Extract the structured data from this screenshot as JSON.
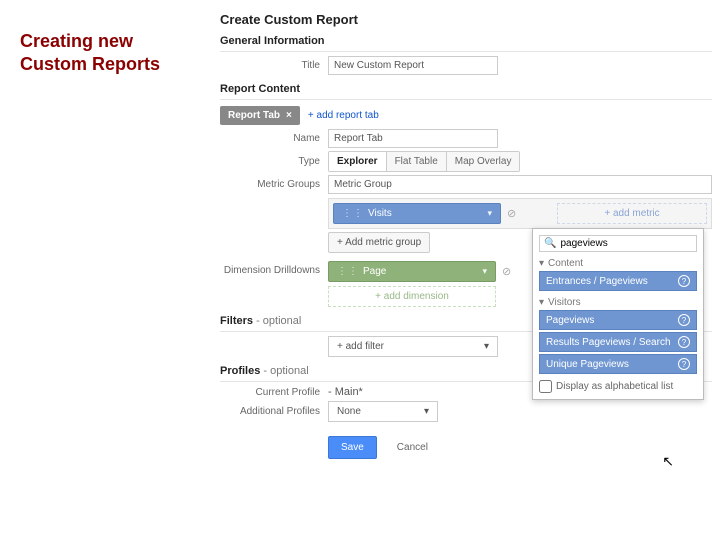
{
  "slide_title": "Creating new Custom Reports",
  "header": {
    "title": "Create Custom Report"
  },
  "general": {
    "heading": "General Information",
    "title_label": "Title",
    "title_value": "New Custom Report"
  },
  "content": {
    "heading": "Report Content",
    "active_tab": "Report Tab",
    "add_tab": "+ add report tab",
    "name_label": "Name",
    "name_value": "Report Tab",
    "type_label": "Type",
    "type_options": [
      "Explorer",
      "Flat Table",
      "Map Overlay"
    ],
    "type_selected": "Explorer",
    "metric_groups_label": "Metric Groups",
    "metric_group_name": "Metric Group",
    "metric_pill": "Visits",
    "add_metric": "+ add metric",
    "add_metric_group": "+ Add metric group",
    "dim_label": "Dimension Drilldowns",
    "dim_pill": "Page",
    "add_dimension": "+ add dimension"
  },
  "filters": {
    "heading": "Filters",
    "optional": " - optional",
    "add_filter": "+ add filter"
  },
  "profiles": {
    "heading": "Profiles",
    "optional": " - optional",
    "current_label": "Current Profile",
    "current_value": "- Main*",
    "additional_label": "Additional Profiles",
    "additional_value": "None"
  },
  "actions": {
    "save": "Save",
    "cancel": "Cancel"
  },
  "picker": {
    "search_value": "pageviews",
    "groups": [
      {
        "name": "Content",
        "items": [
          "Entrances / Pageviews"
        ]
      },
      {
        "name": "Visitors",
        "items": [
          "Pageviews",
          "Results Pageviews / Search",
          "Unique Pageviews"
        ]
      }
    ],
    "alpha_label": "Display as alphabetical list"
  }
}
